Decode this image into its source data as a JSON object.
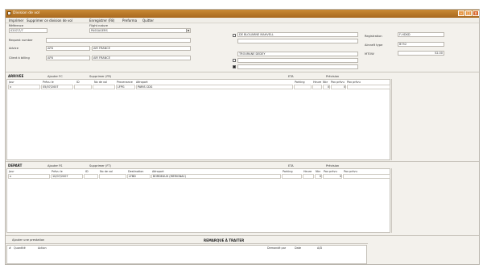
{
  "window": {
    "title": "Division de vol",
    "min": "–",
    "max": "□",
    "close": "x"
  },
  "menu": [
    "Imprimer",
    "Supprimer ce division de vol",
    "Enregistrer (F8)",
    "Preforma",
    "Quitter"
  ],
  "header": {
    "ref_label": "Référence",
    "ref_value": "0207/7/7",
    "flight_nature_label": "Flight nature",
    "flight_nature_value": "PASSAGERS",
    "request_number_label": "Request number",
    "request_number_value": "",
    "advice_label": "Advice",
    "advice_code": "AFN",
    "advice_name": "AIR FRANCE",
    "billing_label": "Client à billing",
    "billing_code": "AFN",
    "billing_name": "AIR FRANCE",
    "crew1": "DE BLOUARNE MAHVELL",
    "crew2": "",
    "crew3": "TROURANE DEDEY",
    "crew4": "",
    "crew5": "",
    "registration_label": "Registration",
    "registration_value": "F-HDKD",
    "aircraft_type_label": "Aircraft type",
    "aircraft_type_value": "B752",
    "mtow_label": "MTOW",
    "mtow_value": "52.00"
  },
  "arrival": {
    "title": "ARRIVEE",
    "add_fc": "Ajouter FC",
    "del_fr": "Supprimer (FR)",
    "eta": "ETA",
    "prevision": "Prévision",
    "columns": [
      "Jour",
      "Prévu le",
      "ID",
      "No de vol",
      "Provenance",
      "Aéroport",
      "Parking",
      "Heure",
      "Nbr",
      "Pax prévu",
      "Pax prévu"
    ],
    "row": {
      "jour": "x",
      "date": "05/07/2007",
      "id": "",
      "flight": "",
      "prov": "LFPG",
      "airport": "PARIS CDG",
      "parking": "",
      "heure": "",
      "nbr": "0",
      "pax1": "0",
      "pax2": ""
    }
  },
  "departure": {
    "title": "DEPART",
    "add_fc": "Ajouter FS",
    "del_fr": "Supprimer (FT)",
    "eta": "ETA",
    "prevision": "Prévision",
    "columns": [
      "Jour",
      "Prévu le",
      "ID",
      "No de vol",
      "Destination",
      "Aéroport",
      "Parking",
      "Heure",
      "Nbr",
      "Pax prévu",
      "Pax prévu"
    ],
    "row": {
      "jour": "x",
      "date": "10/07/2007",
      "id": "",
      "flight": "",
      "dest": "LFBD",
      "airport": "BORDEAUX (MERIGNAC)",
      "parking": "",
      "heure": "",
      "nbr": "0",
      "pax1": "0",
      "pax2": ""
    }
  },
  "remarks": {
    "add_label": "Ajouter une prestation",
    "title": "REMARQUE À TRAITER",
    "columns": [
      "#",
      "Quantité",
      "Action",
      "Demandé par",
      "Date",
      "A/D"
    ]
  }
}
